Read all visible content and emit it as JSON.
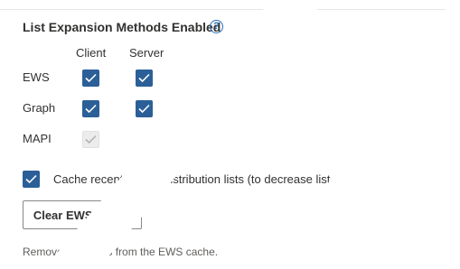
{
  "section": {
    "title": "List Expansion Methods Enabled",
    "help_glyph": "?"
  },
  "columns": {
    "client": "Client",
    "server": "Server"
  },
  "methods": [
    {
      "label": "EWS",
      "client": "checked",
      "server": "checked"
    },
    {
      "label": "Graph",
      "client": "checked",
      "server": "checked"
    },
    {
      "label": "MAPI",
      "client": "checked-disabled",
      "server": null
    }
  ],
  "cache_option": {
    "label": "Cache recently used distribution lists (to decrease list expansion times)",
    "state": "checked"
  },
  "clear_button": {
    "label": "Clear EWS Cache"
  },
  "clear_hint": "Remove all entries from the EWS cache.",
  "colors": {
    "checkbox_checked": "#2b5f98",
    "checkbox_disabled": "#ececec",
    "help_accent": "#2b6cb8",
    "text": "#323130",
    "hint_text": "#605e5c"
  },
  "icons": {
    "help": "help-circle-icon",
    "check": "checkmark-icon"
  }
}
